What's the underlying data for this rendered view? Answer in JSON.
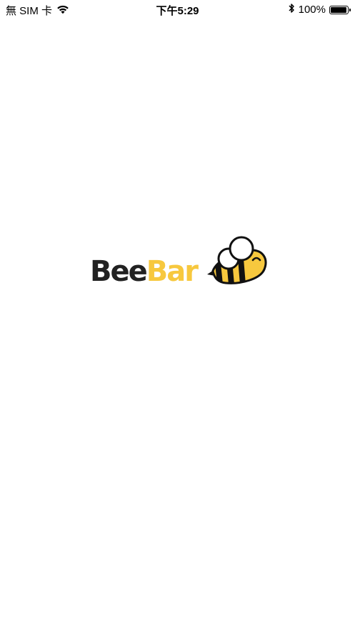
{
  "status_bar": {
    "carrier": "無 SIM 卡",
    "time": "下午5:29",
    "battery_text": "100%",
    "battery_level": 1.0,
    "icons": [
      "wifi-icon",
      "bluetooth-icon",
      "battery-icon"
    ]
  },
  "logo": {
    "word_dark": "Bee",
    "word_yellow": "Bar",
    "colors": {
      "dark": "#222222",
      "yellow": "#f7c83e",
      "outline": "#111111"
    }
  }
}
